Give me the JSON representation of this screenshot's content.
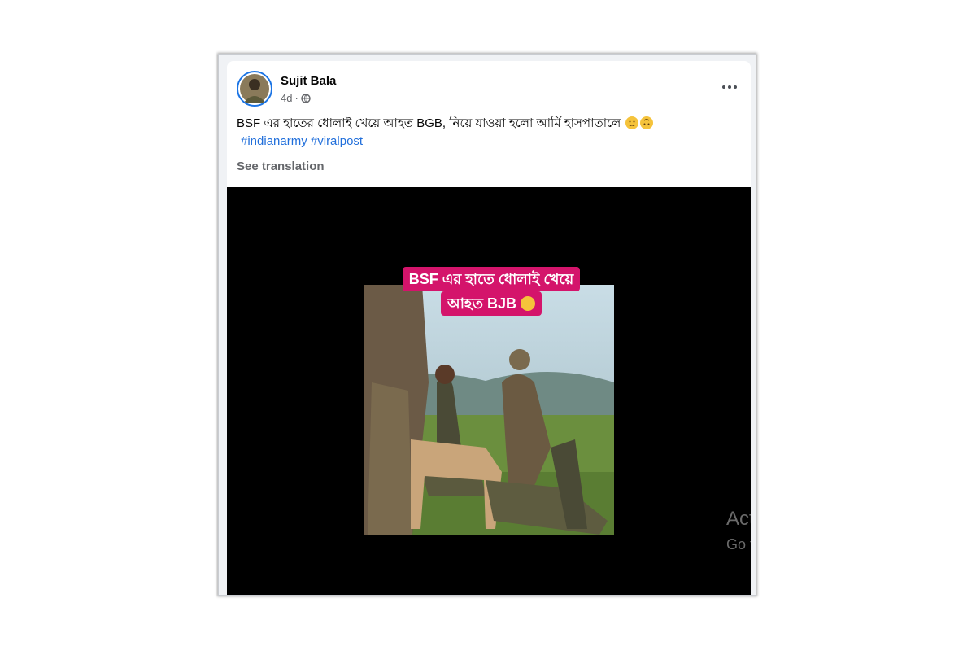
{
  "post": {
    "author": "Sujit Bala",
    "time": "4d",
    "separator": "·",
    "privacy_icon": "globe-icon",
    "text": "BSF এর হাতের ধোলাই খেয়ে আহত BGB, নিয়ে যাওয়া হলো আর্মি হাসপাতালে",
    "emojis": [
      "sad-face-emoji",
      "upside-down-face-emoji"
    ],
    "hashtags": [
      "#indianarmy",
      "#viralpost"
    ],
    "see_translation": "See translation",
    "more_icon": "more-options-icon"
  },
  "video": {
    "caption_line1": "BSF এর হাতে ধোলাই খেয়ে",
    "caption_line2": "আহত BJB"
  },
  "watermark": {
    "line1": "Act",
    "line2": "Go t"
  },
  "colors": {
    "link": "#216fdb",
    "caption_bg": "#d4146b",
    "video_bg": "#000000",
    "avatar_ring": "#1b74e4"
  }
}
